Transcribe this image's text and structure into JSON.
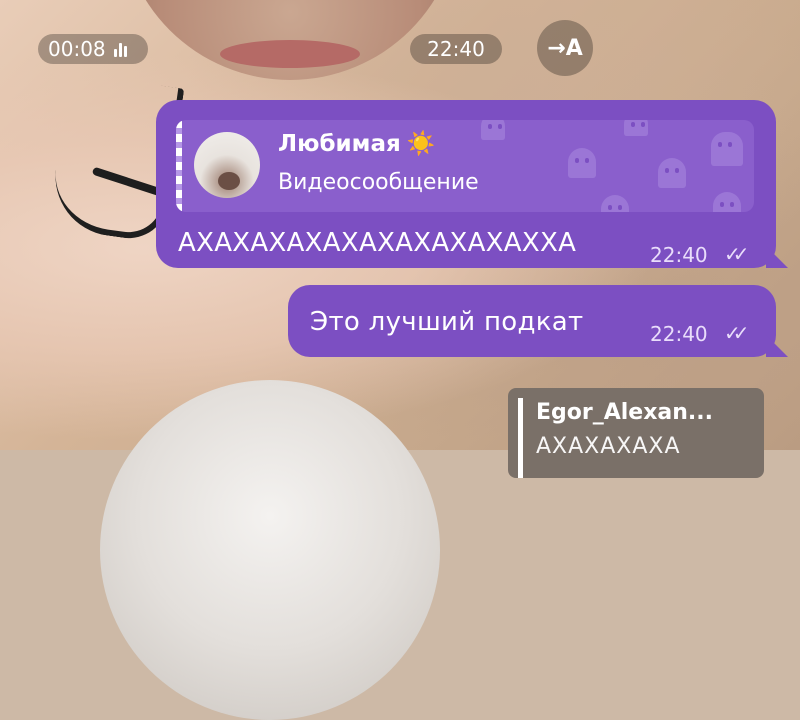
{
  "video_top": {
    "duration": "00:08",
    "time": "22:40"
  },
  "translate_button": {
    "label": "→A"
  },
  "message1": {
    "reply": {
      "sender": "Любимая",
      "emoji": "☀️",
      "type": "Видеосообщение"
    },
    "text": "АХАХАХАХАХАХАХАХАХАХХА",
    "time": "22:40",
    "status": "✓✓"
  },
  "message2": {
    "text": "Это лучший подкат",
    "time": "22:40",
    "status": "✓✓"
  },
  "reply_card": {
    "name": "Egor_Alexan...",
    "preview": "АХАХАХАХА"
  },
  "colors": {
    "bubble": "#7c4fc2",
    "reply_bg": "#8a5fcc"
  }
}
